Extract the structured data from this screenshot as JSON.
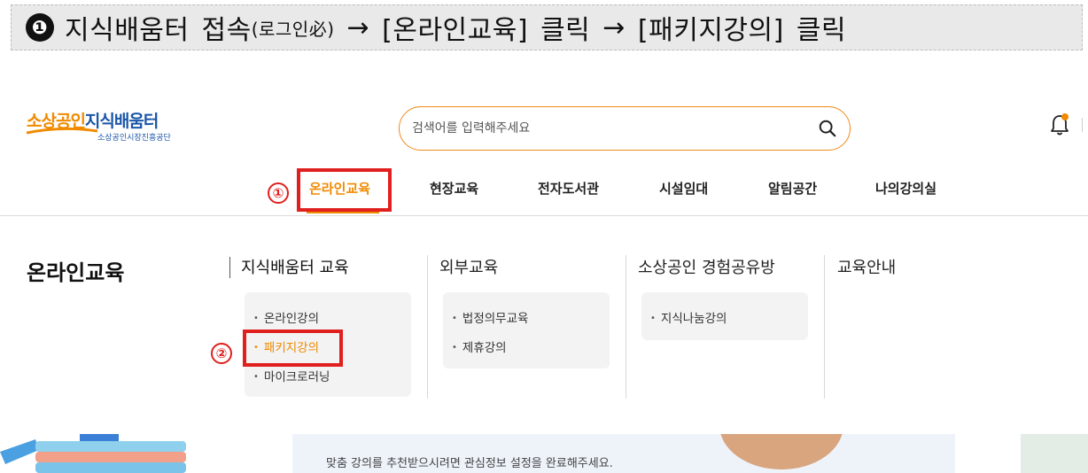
{
  "banner": {
    "step_number": "❶",
    "part1": "지식배움터",
    "part2": "접속",
    "note": "(로그인必)",
    "arrow1": "→",
    "part3": "[온라인교육]",
    "part4": "클릭",
    "arrow2": "→",
    "part5": "[패키지강의]",
    "part6": "클릭"
  },
  "logo": {
    "orange_text": "소상공인",
    "blue_text": "지식배움터",
    "sub_text": "소상공인시장진흥공단"
  },
  "search": {
    "placeholder": "검색어를 입력해주세요",
    "icon": "search-icon"
  },
  "header": {
    "bell_icon": "bell-icon",
    "accent_color": "#f08a00"
  },
  "nav": {
    "items": [
      {
        "label": "온라인교육",
        "active": true
      },
      {
        "label": "현장교육"
      },
      {
        "label": "전자도서관"
      },
      {
        "label": "시설임대"
      },
      {
        "label": "알림공간"
      },
      {
        "label": "나의강의실"
      }
    ],
    "marker1": "①"
  },
  "mega": {
    "title": "온라인교육",
    "marker2": "②",
    "columns": [
      {
        "title": "지식배움터 교육",
        "items": [
          "온라인강의",
          "패키지강의",
          "마이크로러닝"
        ],
        "active_index": 1
      },
      {
        "title": "외부교육",
        "items": [
          "법정의무교육",
          "제휴강의"
        ]
      },
      {
        "title": "소상공인 경험공유방",
        "items": [
          "지식나눔강의"
        ]
      },
      {
        "title": "교육안내",
        "items": []
      }
    ]
  },
  "bottom": {
    "text": "맞춤 강의를 추천받으시려면 관심정보 설정을 완료해주세요."
  },
  "colors": {
    "highlight_red": "#e0201e",
    "brand_blue": "#1a56a8"
  }
}
